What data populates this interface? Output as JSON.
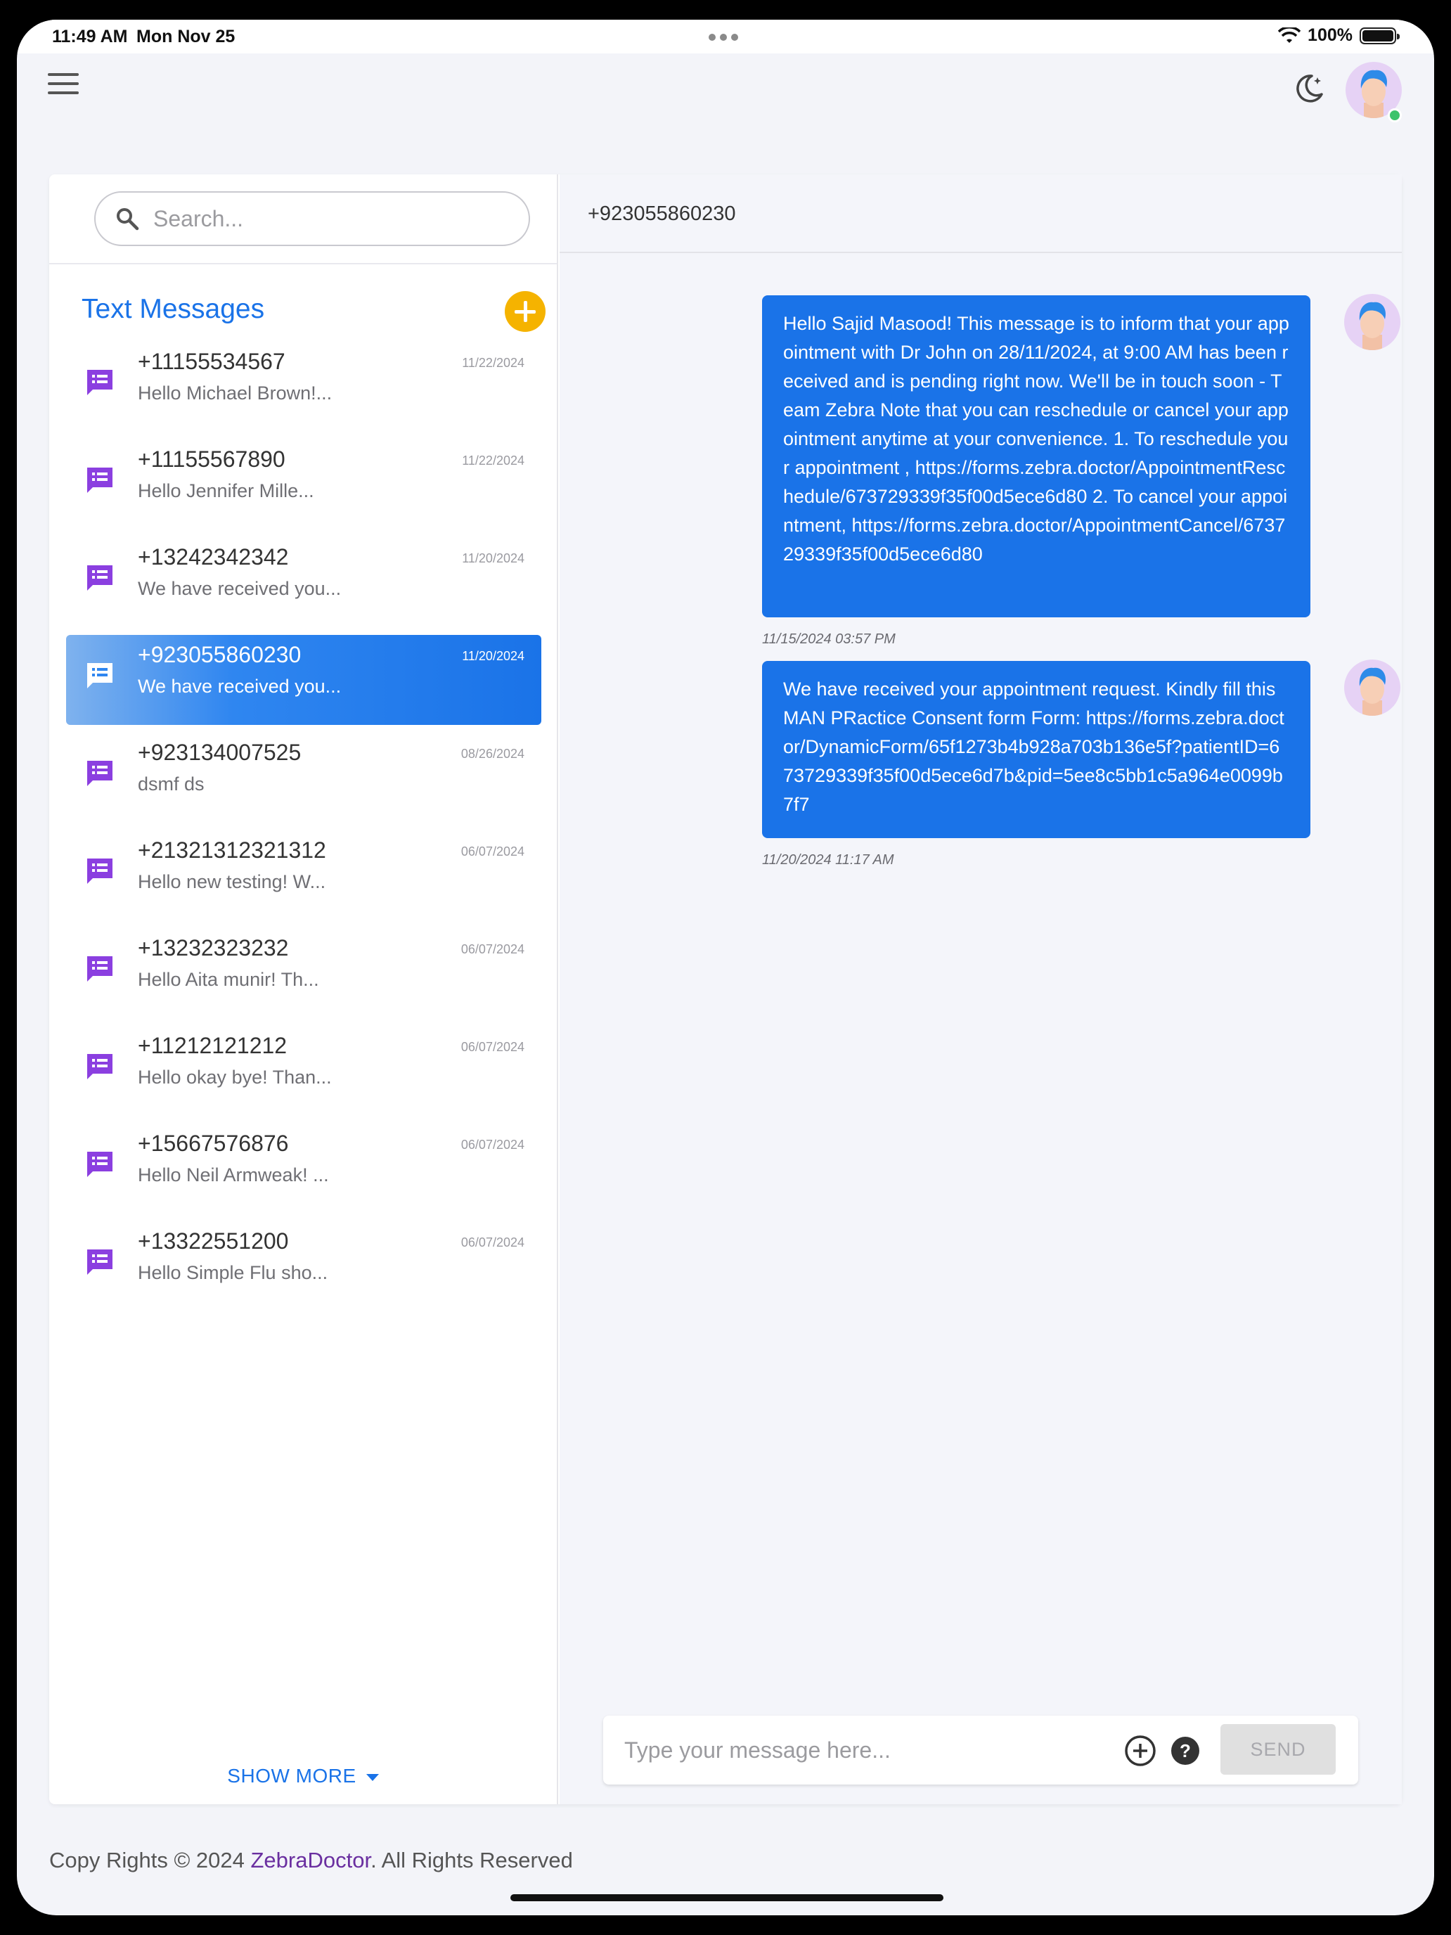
{
  "status_bar": {
    "time": "11:49 AM",
    "date": "Mon Nov 25",
    "battery": "100%"
  },
  "sidebar": {
    "search_placeholder": "Search...",
    "title": "Text Messages",
    "show_more_label": "SHOW MORE",
    "threads": [
      {
        "phone": "+11155534567",
        "date": "11/22/2024",
        "preview": "Hello Michael Brown!..."
      },
      {
        "phone": "+11155567890",
        "date": "11/22/2024",
        "preview": "Hello Jennifer Mille..."
      },
      {
        "phone": "+13242342342",
        "date": "11/20/2024",
        "preview": "We have received you..."
      },
      {
        "phone": "+923055860230",
        "date": "11/20/2024",
        "preview": "We have received you...",
        "active": true
      },
      {
        "phone": "+923134007525",
        "date": "08/26/2024",
        "preview": "dsmf ds"
      },
      {
        "phone": "+21321312321312",
        "date": "06/07/2024",
        "preview": "Hello new testing! W..."
      },
      {
        "phone": "+13232323232",
        "date": "06/07/2024",
        "preview": "Hello Aita munir! Th..."
      },
      {
        "phone": "+11212121212",
        "date": "06/07/2024",
        "preview": "Hello okay bye! Than..."
      },
      {
        "phone": "+15667576876",
        "date": "06/07/2024",
        "preview": "Hello Neil Armweak! ..."
      },
      {
        "phone": "+13322551200",
        "date": "06/07/2024",
        "preview": "Hello Simple Flu sho..."
      }
    ]
  },
  "chat": {
    "header": "+923055860230",
    "messages": [
      {
        "text": "Hello Sajid Masood! This message is to inform that your appointment with Dr John on 28/11/2024, at 9:00 AM has been received and is pending right now. We'll be in touch soon - Team Zebra Note that you can reschedule or cancel your appointment anytime at your convenience. 1. To reschedule your appointment , https://forms.zebra.doctor/AppointmentReschedule/673729339f35f00d5ece6d80 2. To cancel your appointment, https://forms.zebra.doctor/AppointmentCancel/673729339f35f00d5ece6d80",
        "time": "11/15/2024 03:57 PM"
      },
      {
        "text": "We have received your appointment request. Kindly fill this MAN PRactice Consent form Form: https://forms.zebra.doctor/DynamicForm/65f1273b4b928a703b136e5f?patientID=673729339f35f00d5ece6d7b&pid=5ee8c5bb1c5a964e0099b7f7",
        "time": "11/20/2024 11:17 AM"
      }
    ],
    "input_placeholder": "Type your message here...",
    "send_label": "SEND"
  },
  "footer": {
    "prefix": "Copy Rights © 2024 ",
    "brand": "ZebraDoctor",
    "suffix": ". All Rights Reserved"
  },
  "icons": {
    "menu": "hamburger-icon",
    "theme": "moon-stars-icon",
    "search": "search-icon",
    "add": "plus-circle-icon",
    "thread": "message-list-icon",
    "attach": "plus-circle-outline-icon",
    "help": "help-circle-icon",
    "show_more": "caret-down-icon"
  },
  "colors": {
    "accent": "#1a73e8",
    "thread_icon": "#8b3fe0",
    "add_button": "#f5b300",
    "brand": "#6a2fa0",
    "online": "#3cc36b"
  }
}
